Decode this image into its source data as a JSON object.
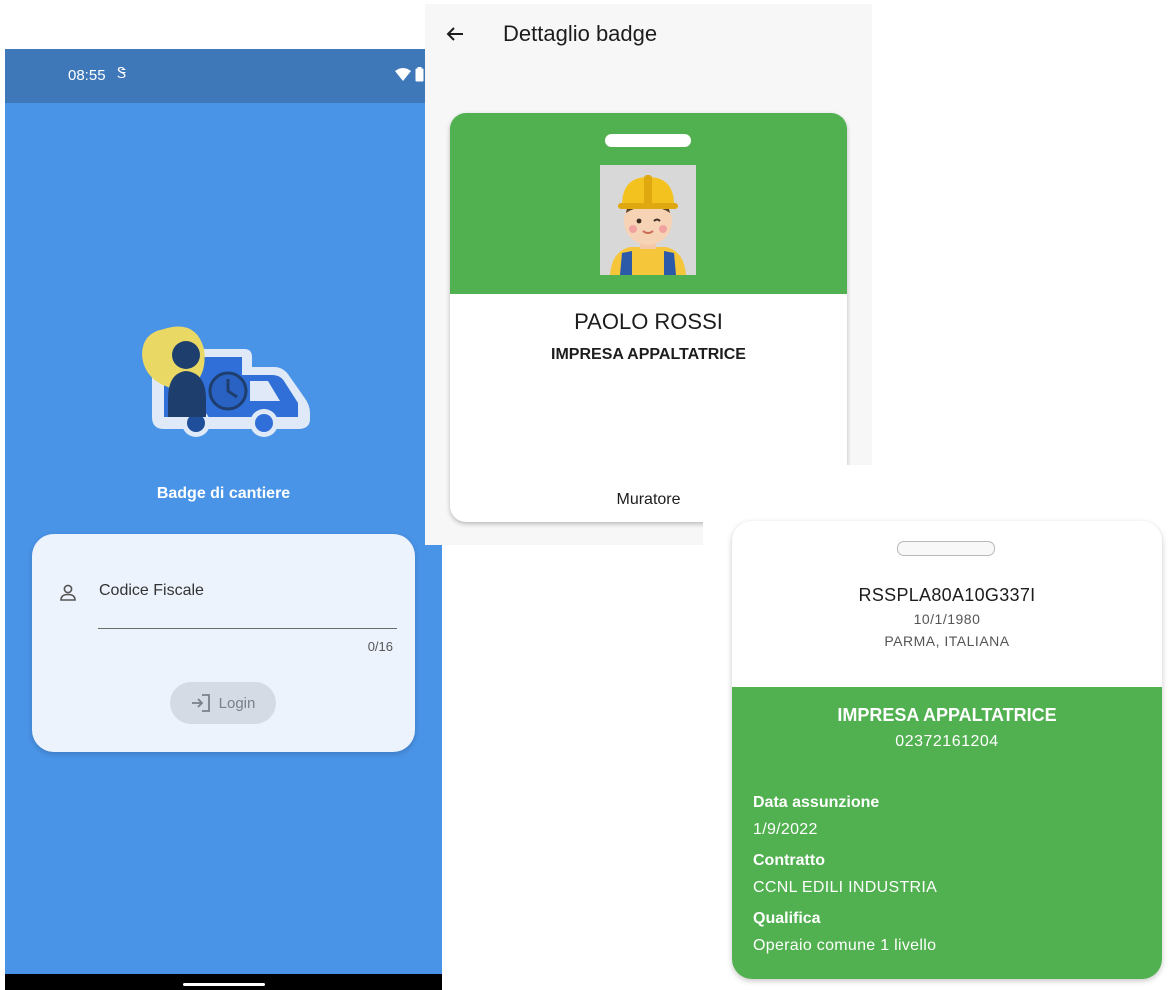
{
  "login": {
    "status_time": "08:55",
    "status_sim_icon": "sim-icon",
    "status_icons": [
      "wifi-icon",
      "battery-icon"
    ],
    "app_title": "Badge di cantiere",
    "field_label": "Codice Fiscale",
    "field_value": "",
    "field_counter": "0/16",
    "login_label": "Login",
    "colors": {
      "background": "#4a94e8",
      "status_bar": "#3f78b9",
      "card": "#edf3fd"
    }
  },
  "detail": {
    "title": "Dettaglio badge",
    "back_icon": "arrow-left-icon",
    "front": {
      "name": "PAOLO ROSSI",
      "company": "IMPRESA APPALTATRICE",
      "role": "Muratore",
      "header_color": "#51b04f"
    },
    "back": {
      "fiscal_code": "RSSPLA80A10G337I",
      "birth_date": "10/1/1980",
      "birth_place": "PARMA, ITALIANA",
      "employer": "IMPRESA APPALTATRICE",
      "vat": "02372161204",
      "fields": [
        {
          "label": "Data assunzione",
          "value": "1/9/2022"
        },
        {
          "label": "Contratto",
          "value": "CCNL EDILI INDUSTRIA"
        },
        {
          "label": "Qualifica",
          "value": "Operaio comune 1 livello"
        }
      ]
    }
  }
}
